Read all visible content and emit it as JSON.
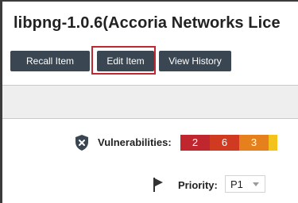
{
  "header": {
    "title": "libpng-1.0.6(Accoria Networks Lice"
  },
  "toolbar": {
    "recall_label": "Recall Item",
    "edit_label": "Edit Item",
    "history_label": "View History"
  },
  "vulnerabilities": {
    "label": "Vulnerabilities:",
    "icon": "shield-x-icon",
    "counts": [
      {
        "severity": "critical",
        "value": "2",
        "color": "#c0262d"
      },
      {
        "severity": "high",
        "value": "6",
        "color": "#d03a20"
      },
      {
        "severity": "medium",
        "value": "3",
        "color": "#e6801c"
      },
      {
        "severity": "low",
        "value": "",
        "color": "#f3c21b"
      }
    ]
  },
  "priority": {
    "label": "Priority:",
    "icon": "flag-icon",
    "selected": "P1"
  },
  "colors": {
    "button_bg": "#3a4752",
    "highlight": "#c0282f"
  }
}
